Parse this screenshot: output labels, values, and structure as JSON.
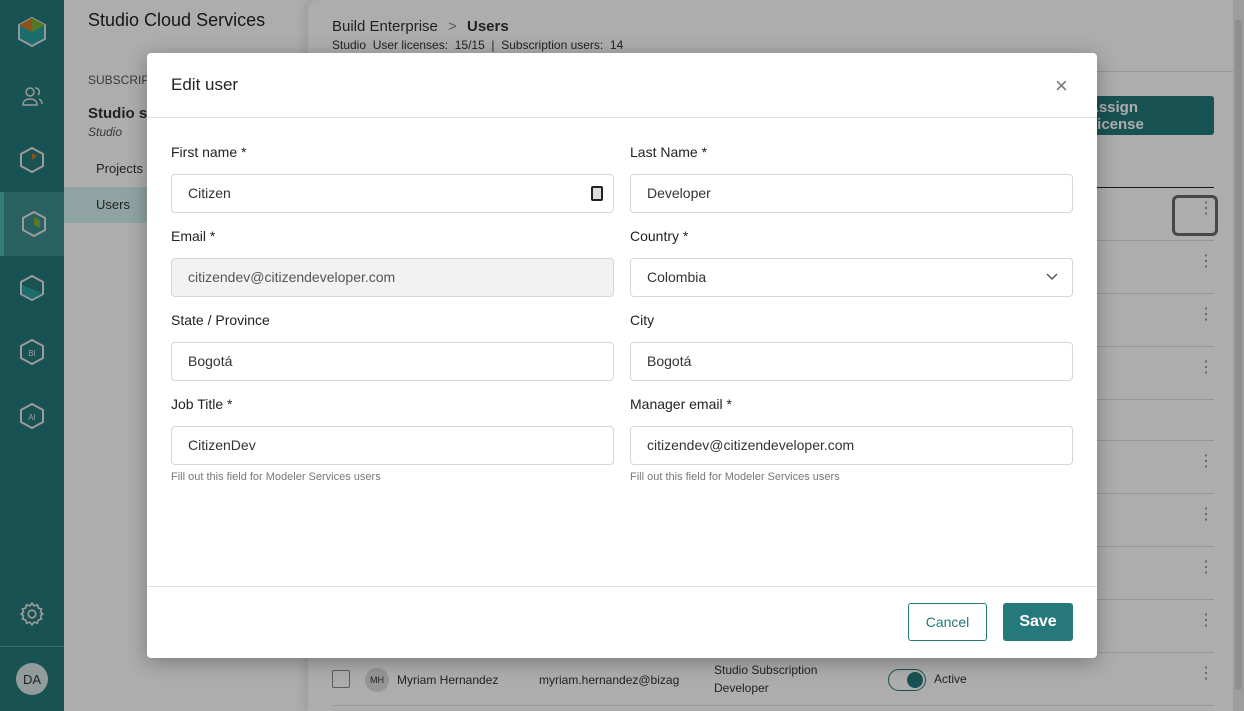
{
  "sidebar": {
    "items": [
      "logo",
      "users",
      "modeler",
      "studio",
      "automation",
      "bi",
      "ai"
    ],
    "avatar": "DA",
    "accent": "#25797a"
  },
  "nav": {
    "title": "Studio Cloud Services",
    "section": "SUBSCRIPTIONS",
    "plan": "Studio st",
    "plan_sub": "Studio",
    "items": [
      {
        "label": "Projects"
      },
      {
        "label": "Users"
      }
    ]
  },
  "main": {
    "breadcrumb_parent": "Build Enterprise",
    "breadcrumb_sep": ">",
    "breadcrumb_current": "Users",
    "licenses": "Studio  User licenses:  15/15  |  Subscription users:  14",
    "assign_label": "Assign License",
    "last_row": {
      "initials": "MH",
      "name": "Myriam Hernandez",
      "email": "myriam.hernandez@bizagi.com",
      "role_line1": "Studio Subscription",
      "role_line2": "Developer",
      "status": "Active"
    }
  },
  "modal": {
    "title": "Edit user",
    "close": "×",
    "fields": {
      "first_name": {
        "label": "First name *",
        "value": "Citizen"
      },
      "last_name": {
        "label": "Last Name *",
        "value": "Developer"
      },
      "email": {
        "label": "Email *",
        "value": "citizendev@citizendeveloper.com"
      },
      "country": {
        "label": "Country *",
        "value": "Colombia"
      },
      "state": {
        "label": "State / Province",
        "value": "Bogotá"
      },
      "city": {
        "label": "City",
        "value": "Bogotá"
      },
      "job_title": {
        "label": "Job Title *",
        "value": "CitizenDev",
        "help": "Fill out this field for Modeler Services users"
      },
      "manager_email": {
        "label": "Manager email *",
        "value": "citizendev@citizendeveloper.com",
        "help": "Fill out this field for Modeler Services users"
      }
    },
    "cancel": "Cancel",
    "save": "Save"
  }
}
